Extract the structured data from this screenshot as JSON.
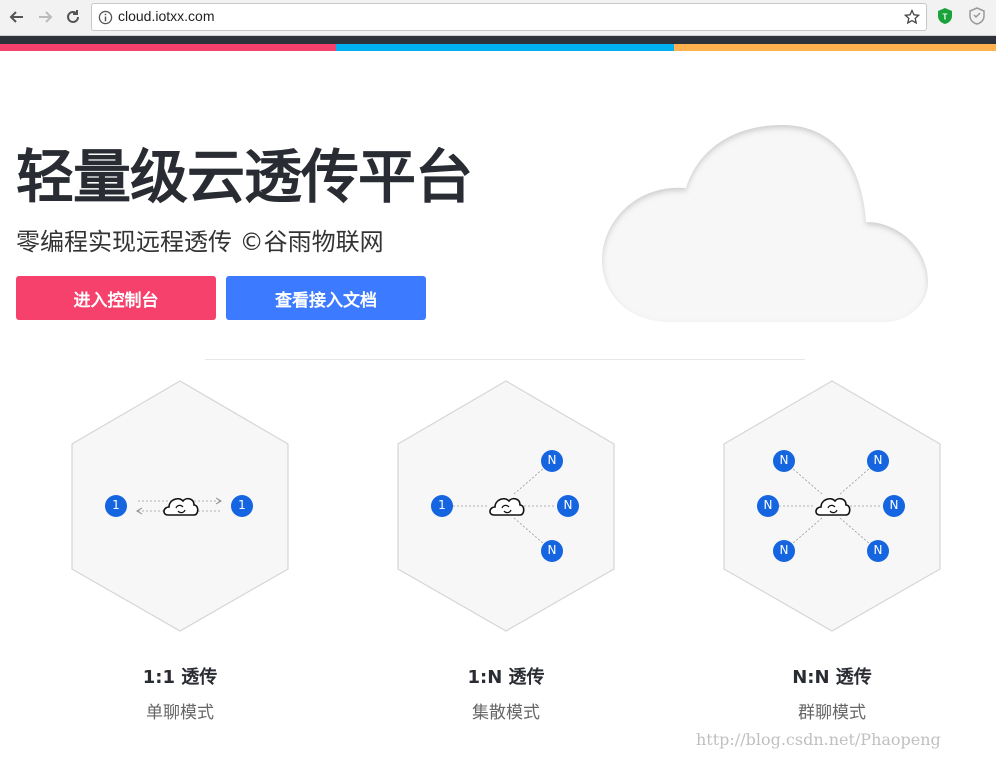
{
  "browser": {
    "url": "cloud.iotxx.com",
    "icons": [
      "back-arrow-icon",
      "forward-arrow-icon",
      "reload-icon",
      "info-icon",
      "star-icon",
      "shield-extension-icon",
      "shield-outline-icon"
    ]
  },
  "colors": {
    "dark_bar": "#2c313a",
    "stripe_pink": "#f5416c",
    "stripe_blue": "#00b0f0",
    "stripe_orange": "#ffb14e",
    "button_pink": "#f5416c",
    "button_blue": "#3c7bff",
    "node_blue": "#1565e0"
  },
  "hero": {
    "title": "轻量级云透传平台",
    "subtitle": "零编程实现远程透传 ©谷雨物联网",
    "primary_button": "进入控制台",
    "secondary_button": "查看接入文档"
  },
  "features": [
    {
      "title": "1:1 透传",
      "desc": "单聊模式",
      "left_label": "1",
      "right_label": "1"
    },
    {
      "title": "1:N 透传",
      "desc": "集散模式",
      "left_label": "1",
      "node_label": "N"
    },
    {
      "title": "N:N 透传",
      "desc": "群聊模式",
      "node_label": "N"
    }
  ],
  "watermark": "http://blog.csdn.net/Phaopeng"
}
